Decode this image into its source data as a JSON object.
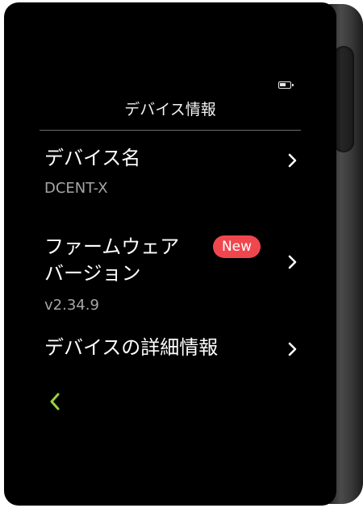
{
  "screen": {
    "title": "デバイス情報",
    "battery_level": 0.6
  },
  "items": [
    {
      "label": "デバイス名",
      "value": "DCENT-X"
    },
    {
      "label_line1": "ファームウェア",
      "label_line2": "バージョン",
      "value": "v2.34.9",
      "badge": "New"
    },
    {
      "label": "デバイスの詳細情報"
    }
  ],
  "colors": {
    "accent_back": "#9bd13c",
    "badge": "#f0474e",
    "secondary_text": "#a6a6a6"
  },
  "icons": {
    "battery": "battery-icon",
    "chevron": "chevron-right-icon",
    "back": "chevron-left-icon"
  }
}
